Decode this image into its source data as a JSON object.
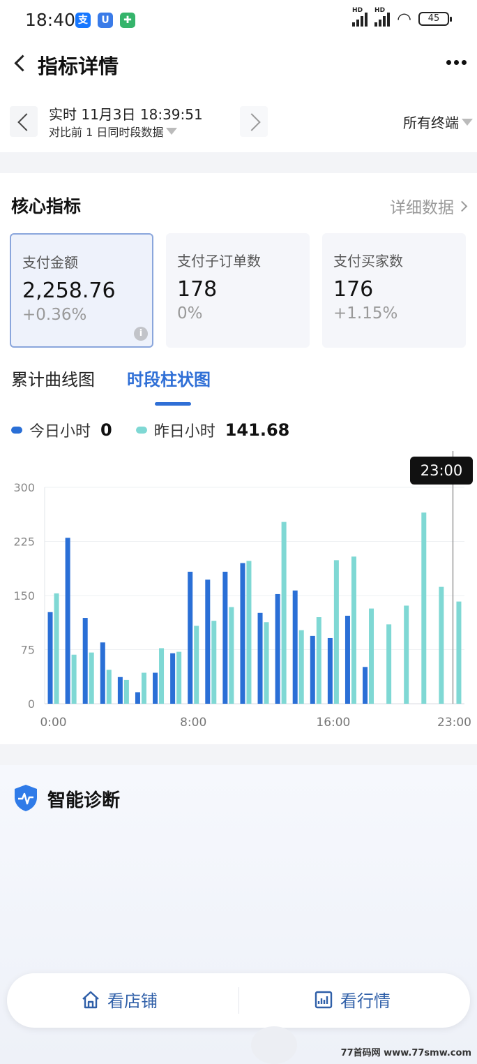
{
  "status": {
    "time": "18:40",
    "battery": "45",
    "hd_label": "HD",
    "app_badges": [
      {
        "glyph": "支",
        "color": "#1677ff"
      },
      {
        "glyph": "U",
        "color": "#3a7be8"
      },
      {
        "glyph": "✚",
        "color": "#35b46b"
      }
    ]
  },
  "nav": {
    "title": "指标详情"
  },
  "timebar": {
    "realtime": "实时 11月3日 18:39:51",
    "compare": "对比前 1 日同时段数据",
    "terminal": "所有终端"
  },
  "core": {
    "title": "核心指标",
    "detail_link": "详细数据",
    "cards": [
      {
        "label": "支付金额",
        "value": "2,258.76",
        "change": "+0.36%",
        "info": "i"
      },
      {
        "label": "支付子订单数",
        "value": "178",
        "change": "0%"
      },
      {
        "label": "支付买家数",
        "value": "176",
        "change": "+1.15%"
      }
    ]
  },
  "tabs": [
    {
      "label": "累计曲线图"
    },
    {
      "label": "时段柱状图"
    }
  ],
  "legend": [
    {
      "label": "今日小时",
      "value": "0",
      "color": "#2a6fd6"
    },
    {
      "label": "昨日小时",
      "value": "141.68",
      "color": "#7fd8d4"
    }
  ],
  "chart_data": {
    "type": "bar",
    "categories": [
      "0:00",
      "1:00",
      "2:00",
      "3:00",
      "4:00",
      "5:00",
      "6:00",
      "7:00",
      "8:00",
      "9:00",
      "10:00",
      "11:00",
      "12:00",
      "13:00",
      "14:00",
      "15:00",
      "16:00",
      "17:00",
      "18:00",
      "19:00",
      "20:00",
      "21:00",
      "22:00",
      "23:00"
    ],
    "series": [
      {
        "name": "今日小时",
        "color": "#2a6fd6",
        "values": [
          127,
          230,
          119,
          85,
          37,
          16,
          43,
          70,
          183,
          172,
          183,
          195,
          126,
          152,
          157,
          94,
          91,
          122,
          51,
          null,
          null,
          null,
          null,
          0
        ]
      },
      {
        "name": "昨日小时",
        "color": "#7fd8d4",
        "values": [
          153,
          68,
          71,
          47,
          33,
          43,
          77,
          72,
          108,
          115,
          134,
          198,
          113,
          252,
          102,
          120,
          199,
          204,
          132,
          110,
          136,
          265,
          162,
          141.68
        ]
      }
    ],
    "yticks": [
      0,
      75,
      150,
      225,
      300
    ],
    "xtick_labels": [
      "0:00",
      "8:00",
      "16:00",
      "23:00"
    ],
    "ylim": [
      0,
      300
    ],
    "grid": true,
    "tooltip": "23:00"
  },
  "diagnose": {
    "title": "智能诊断"
  },
  "bottom": {
    "shop": "看店铺",
    "market": "看行情"
  },
  "watermark": "77首码网 www.77smw.com"
}
